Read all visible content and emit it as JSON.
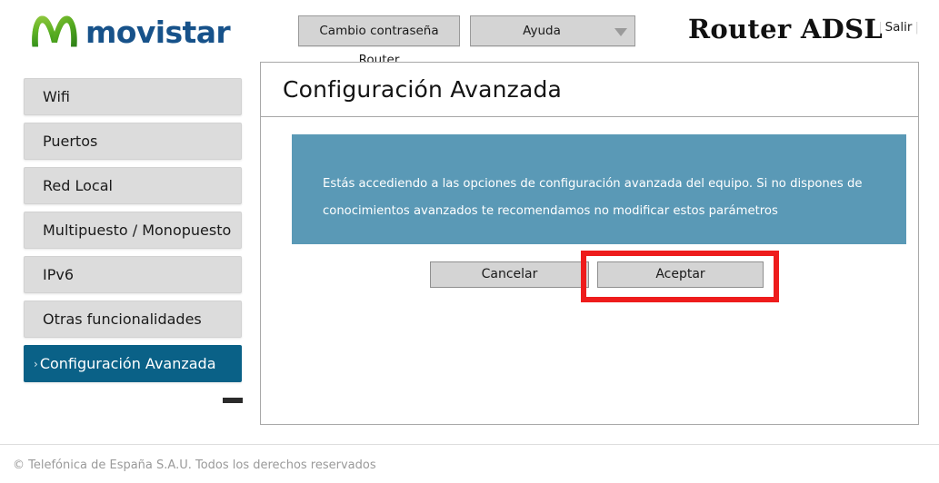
{
  "header": {
    "logo_word": "movistar",
    "logo_icon": "movistar-m-logo",
    "buttons": {
      "cambio_password": "Cambio contraseña Router",
      "ayuda": "Ayuda",
      "ayuda_arrow_icon": "chevron-down-icon"
    },
    "product_title": "Router ADSL",
    "logout_label": "Salir",
    "logout_separator": "|"
  },
  "sidebar": {
    "active_chevron": "›",
    "items": [
      {
        "label": "Wifi",
        "active": false
      },
      {
        "label": "Puertos",
        "active": false
      },
      {
        "label": "Red Local",
        "active": false
      },
      {
        "label": "Multipuesto / Monopuesto",
        "active": false
      },
      {
        "label": "IPv6",
        "active": false
      },
      {
        "label": "Otras funcionalidades",
        "active": false
      },
      {
        "label": "Configuración Avanzada",
        "active": true
      }
    ],
    "collapse_icon": "minus-collapse-icon"
  },
  "panel": {
    "title": "Configuración Avanzada",
    "info_message": "Estás accediendo a las opciones de configuración avanzada del equipo. Si no dispones de conocimientos avanzados te recomendamos no modificar estos parámetros",
    "buttons": {
      "cancel": "Cancelar",
      "accept": "Aceptar"
    },
    "highlight": {
      "target": "accept-button",
      "color": "#ee1c1c"
    }
  },
  "footer": {
    "copyright": "© Telefónica de España S.A.U. Todos los derechos reservados"
  },
  "colors": {
    "brand_blue": "#17528a",
    "brand_green": "#6ec62a",
    "active_nav": "#0a6187",
    "info_box": "#5a99b6",
    "button_face": "#d4d4d4",
    "highlight_red": "#ee1c1c"
  }
}
